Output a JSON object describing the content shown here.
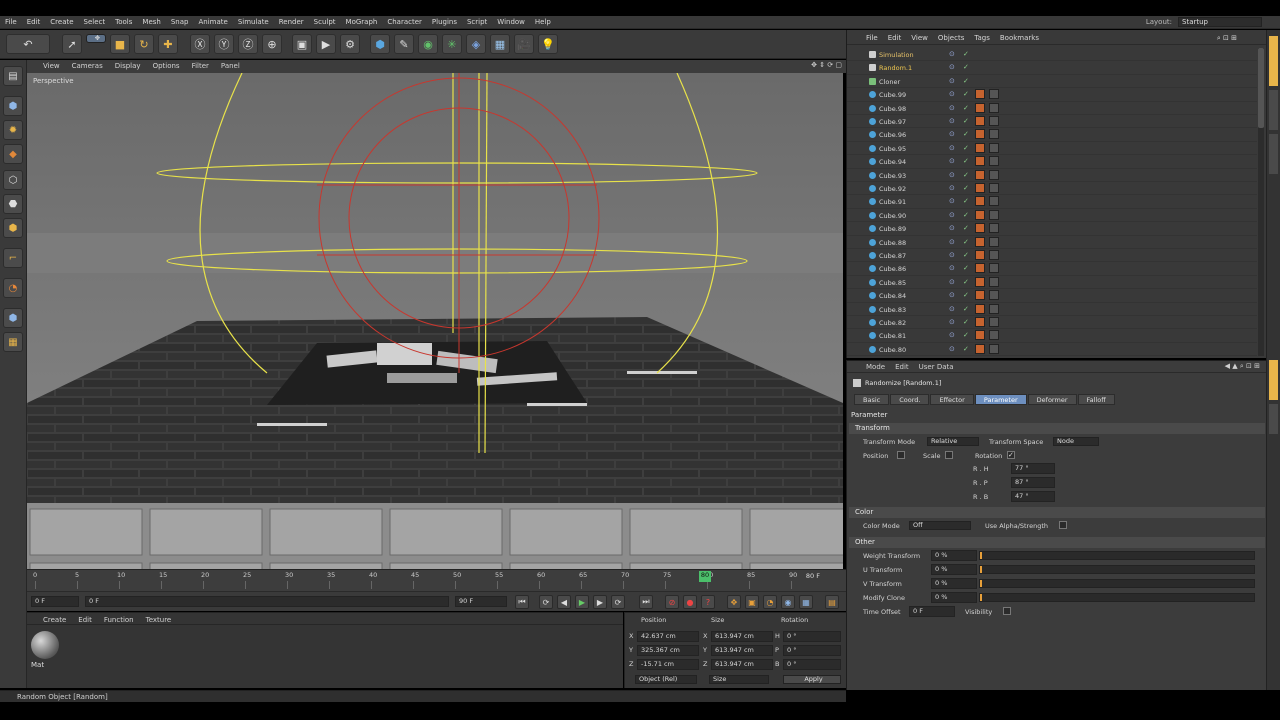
{
  "menubar": {
    "items": [
      "File",
      "Edit",
      "Create",
      "Select",
      "Tools",
      "Mesh",
      "Snap",
      "Animate",
      "Simulate",
      "Render",
      "Sculpt",
      "MoGraph",
      "Character",
      "Plugins",
      "Script",
      "Window",
      "Help"
    ],
    "layout_label": "Layout:",
    "layout_value": "Startup"
  },
  "viewport": {
    "menu": [
      "View",
      "Cameras",
      "Display",
      "Options",
      "Filter",
      "Panel"
    ],
    "camera_label": "Perspective"
  },
  "timeline": {
    "ticks": [
      "0",
      "5",
      "10",
      "15",
      "20",
      "25",
      "30",
      "35",
      "40",
      "45",
      "50",
      "55",
      "60",
      "65",
      "70",
      "75",
      "80",
      "85",
      "90"
    ],
    "current_frame": "80",
    "end_label": "80 F"
  },
  "playbar": {
    "start_frame": "0 F",
    "range_start": "0 F",
    "range_end": "90 F",
    "end_frame": "90 F"
  },
  "material_manager": {
    "menu": [
      "Create",
      "Edit",
      "Function",
      "Texture"
    ],
    "material_name": "Mat"
  },
  "coordinates": {
    "headers": [
      "Position",
      "Size",
      "Rotation"
    ],
    "rows": [
      {
        "axis": "X",
        "position": "42.637 cm",
        "size_axis": "X",
        "size": "613.947 cm",
        "rot_axis": "H",
        "rotation": "0 °"
      },
      {
        "axis": "Y",
        "position": "325.367 cm",
        "size_axis": "Y",
        "size": "613.947 cm",
        "rot_axis": "P",
        "rotation": "0 °"
      },
      {
        "axis": "Z",
        "position": "-15.71 cm",
        "size_axis": "Z",
        "size": "613.947 cm",
        "rot_axis": "B",
        "rotation": "0 °"
      }
    ],
    "mode_select": "Object (Rel)",
    "size_select": "Size",
    "apply_label": "Apply"
  },
  "statusbar": {
    "text": "Random Object [Random]"
  },
  "object_manager": {
    "menu": [
      "File",
      "Edit",
      "View",
      "Objects",
      "Tags",
      "Bookmarks"
    ],
    "objects": [
      {
        "name": "Simulation",
        "color": "#e8c36a"
      },
      {
        "name": "Random.1",
        "color": "#f0c850"
      },
      {
        "name": "Cloner",
        "color": "#d6d6d6"
      },
      {
        "name": "Cube.99",
        "color": "#d6d6d6"
      },
      {
        "name": "Cube.98",
        "color": "#d6d6d6"
      },
      {
        "name": "Cube.97",
        "color": "#d6d6d6"
      },
      {
        "name": "Cube.96",
        "color": "#d6d6d6"
      },
      {
        "name": "Cube.95",
        "color": "#d6d6d6"
      },
      {
        "name": "Cube.94",
        "color": "#d6d6d6"
      },
      {
        "name": "Cube.93",
        "color": "#d6d6d6"
      },
      {
        "name": "Cube.92",
        "color": "#d6d6d6"
      },
      {
        "name": "Cube.91",
        "color": "#d6d6d6"
      },
      {
        "name": "Cube.90",
        "color": "#d6d6d6"
      },
      {
        "name": "Cube.89",
        "color": "#d6d6d6"
      },
      {
        "name": "Cube.88",
        "color": "#d6d6d6"
      },
      {
        "name": "Cube.87",
        "color": "#d6d6d6"
      },
      {
        "name": "Cube.86",
        "color": "#d6d6d6"
      },
      {
        "name": "Cube.85",
        "color": "#d6d6d6"
      },
      {
        "name": "Cube.84",
        "color": "#d6d6d6"
      },
      {
        "name": "Cube.83",
        "color": "#d6d6d6"
      },
      {
        "name": "Cube.82",
        "color": "#d6d6d6"
      },
      {
        "name": "Cube.81",
        "color": "#d6d6d6"
      },
      {
        "name": "Cube.80",
        "color": "#d6d6d6"
      }
    ]
  },
  "attribute_manager": {
    "menu": [
      "Mode",
      "Edit",
      "User Data"
    ],
    "title": "Randomize [Random.1]",
    "tabs": [
      "Basic",
      "Coord.",
      "Effector",
      "Parameter",
      "Deformer",
      "Falloff"
    ],
    "active_tab": "Parameter",
    "section_parameter": "Parameter",
    "transform": {
      "header": "Transform",
      "mode_label": "Transform Mode",
      "mode_value": "Relative",
      "space_label": "Transform Space",
      "space_value": "Node",
      "position_label": "Position",
      "scale_label": "Scale",
      "rotation_label": "Rotation",
      "rot_h_label": "R . H",
      "rot_h": "77 °",
      "rot_p_label": "R . P",
      "rot_p": "87 °",
      "rot_b_label": "R . B",
      "rot_b": "47 °"
    },
    "color": {
      "header": "Color",
      "mode_label": "Color Mode",
      "mode_value": "Off",
      "alpha_label": "Use Alpha/Strength"
    },
    "other": {
      "header": "Other",
      "rows": [
        {
          "label": "Weight Transform",
          "value": "0 %"
        },
        {
          "label": "U Transform",
          "value": "0 %"
        },
        {
          "label": "V Transform",
          "value": "0 %"
        },
        {
          "label": "Modify Clone",
          "value": "0 %"
        }
      ],
      "time_offset_label": "Time Offset",
      "time_offset_value": "0 F",
      "visibility_label": "Visibility"
    }
  },
  "colors": {
    "accent": "#6d8fbf",
    "sphere_yellow": "#e8e24a",
    "sphere_red": "#c8372e"
  }
}
